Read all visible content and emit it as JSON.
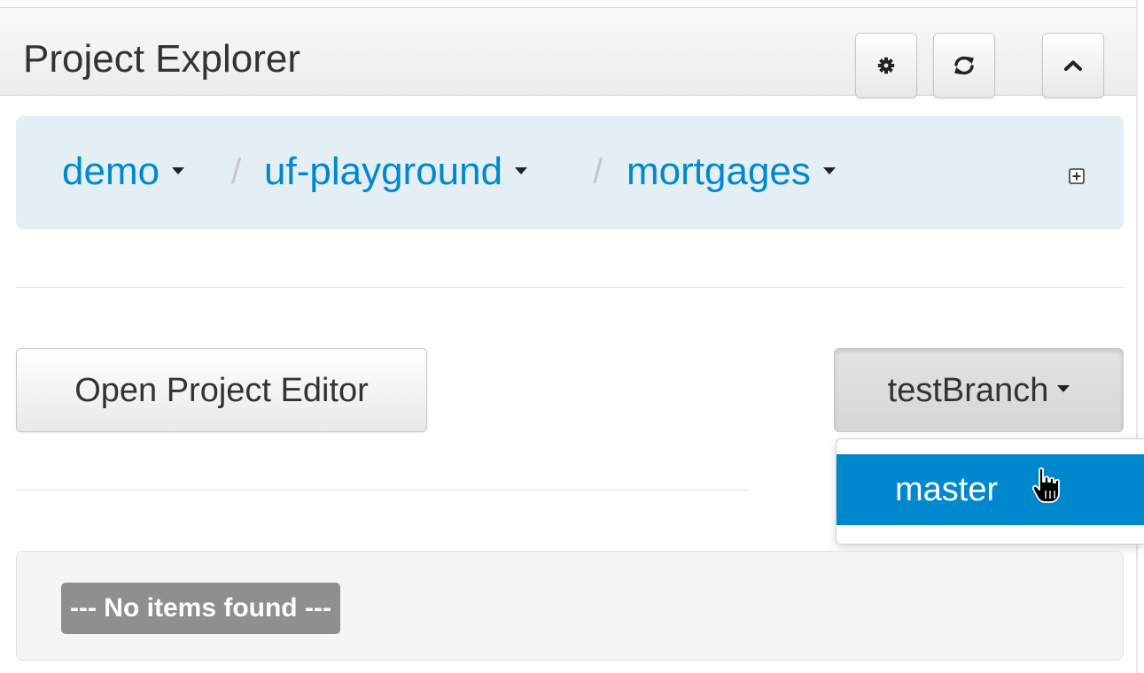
{
  "panel": {
    "title": "Project Explorer",
    "header_buttons": [
      {
        "name": "settings",
        "icon": "gear-icon"
      },
      {
        "name": "refresh",
        "icon": "refresh-icon"
      },
      {
        "name": "collapse",
        "icon": "chevron-up-icon"
      }
    ]
  },
  "breadcrumb": {
    "items": [
      {
        "label": "demo"
      },
      {
        "label": "uf-playground"
      },
      {
        "label": "mortgages"
      }
    ],
    "separator": "/",
    "add_icon": "plus-square-icon"
  },
  "toolbar": {
    "open_editor_label": "Open Project Editor",
    "branch_label": "testBranch"
  },
  "branch_menu": {
    "items": [
      {
        "label": "master",
        "active": true
      }
    ]
  },
  "results": {
    "empty_label": "--- No items found ---"
  },
  "colors": {
    "link": "#0088ce",
    "breadcrumb_bg": "#e4eff5",
    "active_menu_bg": "#0088ce",
    "badge_bg": "#8f8f8f"
  }
}
